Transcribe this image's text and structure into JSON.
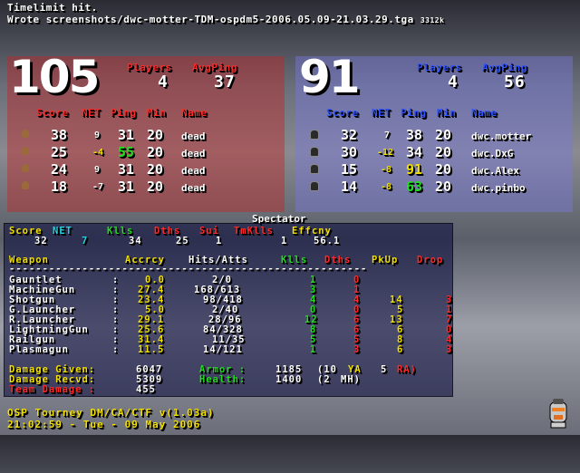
{
  "console": {
    "line1": "Timelimit hit.",
    "line2": "Wrote screenshots/dwc-motter-TDM-ospdm5-2006.05.09-21.03.29.tga",
    "size": "3312k"
  },
  "red_team": {
    "score": "105",
    "players_label": "Players",
    "avgping_label": "AvgPing",
    "players": "4",
    "avgping": "37",
    "headers": [
      "Score",
      "NET",
      "Ping",
      "Min",
      "Name"
    ],
    "rows": [
      {
        "score": "38",
        "net": "9",
        "ping": "31",
        "min": "20",
        "name": "dead"
      },
      {
        "score": "25",
        "net": "-4",
        "ping": "55",
        "min": "20",
        "name": "dead"
      },
      {
        "score": "24",
        "net": "9",
        "ping": "31",
        "min": "20",
        "name": "dead"
      },
      {
        "score": "18",
        "net": "-7",
        "ping": "31",
        "min": "20",
        "name": "dead"
      }
    ]
  },
  "blue_team": {
    "score": "91",
    "players_label": "Players",
    "avgping_label": "AvgPing",
    "players": "4",
    "avgping": "56",
    "headers": [
      "Score",
      "NET",
      "Ping",
      "Min",
      "Name"
    ],
    "rows": [
      {
        "score": "32",
        "net": "7",
        "ping": "38",
        "min": "20",
        "name": "dwc.motter"
      },
      {
        "score": "30",
        "net": "-12",
        "ping": "34",
        "min": "20",
        "name": "dwc.DxG"
      },
      {
        "score": "15",
        "net": "-8",
        "ping": "91",
        "min": "20",
        "name": "dwc.Alex"
      },
      {
        "score": "14",
        "net": "-8",
        "ping": "63",
        "min": "20",
        "name": "dwc.pinbo"
      }
    ]
  },
  "spectator": {
    "title": "Spectator",
    "stat_labels": {
      "score": "Score",
      "net": "NET",
      "kills": "Klls",
      "deaths": "Dths",
      "sui": "Sui",
      "tmklls": "TmKlls",
      "effcny": "Effcny"
    },
    "stat_values": {
      "score": "32",
      "net": "7",
      "kills": "34",
      "deaths": "25",
      "sui": "1",
      "tmklls": "1",
      "effcny": "56.1"
    },
    "weapon_headers": {
      "weapon": "Weapon",
      "accrcy": "Accrcy",
      "hits": "Hits/Atts",
      "kills": "Klls",
      "deaths": "Dths",
      "pkup": "PkUp",
      "drop": "Drop"
    },
    "separator": "------------------------------------------------------",
    "weapons": [
      {
        "name": "Gauntlet",
        "acc": "0.0",
        "hits": "2/0",
        "kills": "1",
        "deaths": "0",
        "pkup": "",
        "drop": ""
      },
      {
        "name": "MachineGun",
        "acc": "27.4",
        "hits": "168/613",
        "kills": "3",
        "deaths": "1",
        "pkup": "",
        "drop": ""
      },
      {
        "name": "Shotgun",
        "acc": "23.4",
        "hits": "98/418",
        "kills": "4",
        "deaths": "4",
        "pkup": "14",
        "drop": "3"
      },
      {
        "name": "G.Launcher",
        "acc": "5.0",
        "hits": "2/40",
        "kills": "0",
        "deaths": "0",
        "pkup": "5",
        "drop": "1"
      },
      {
        "name": "R.Launcher",
        "acc": "29.1",
        "hits": "28/96",
        "kills": "12",
        "deaths": "6",
        "pkup": "13",
        "drop": "7"
      },
      {
        "name": "LightningGun",
        "acc": "25.6",
        "hits": "84/328",
        "kills": "8",
        "deaths": "6",
        "pkup": "6",
        "drop": "0"
      },
      {
        "name": "Railgun",
        "acc": "31.4",
        "hits": "11/35",
        "kills": "5",
        "deaths": "5",
        "pkup": "8",
        "drop": "4"
      },
      {
        "name": "Plasmagun",
        "acc": "11.5",
        "hits": "14/121",
        "kills": "1",
        "deaths": "3",
        "pkup": "6",
        "drop": "3"
      }
    ],
    "damage_given_label": "Damage Given:",
    "damage_given": "6047",
    "damage_recvd_label": "Damage Recvd:",
    "damage_recvd": "5309",
    "team_damage_label": "Team Damage :",
    "team_damage": "455",
    "armor_label": "Armor :",
    "armor": "1185",
    "armor_detail_a": "(10",
    "armor_ya": "YA",
    "armor_detail_b": "5",
    "armor_ra": "RA)",
    "health_label": "Health:",
    "health": "1400",
    "health_detail": "(2",
    "health_mh": "MH)"
  },
  "footer": {
    "line1": "OSP Tourney DM/CA/CTF v(1.03a)",
    "line2": "21:02:59 - Tue - 09 May 2006"
  },
  "colors": {
    "red_team": "#ff2a2a",
    "blue_team": "#3355ff",
    "label_yellow": "#f2e000",
    "green": "#22dd22",
    "cyan": "#22d6e6"
  },
  "icons": [
    "player-head-icon",
    "sarge-head-icon"
  ]
}
